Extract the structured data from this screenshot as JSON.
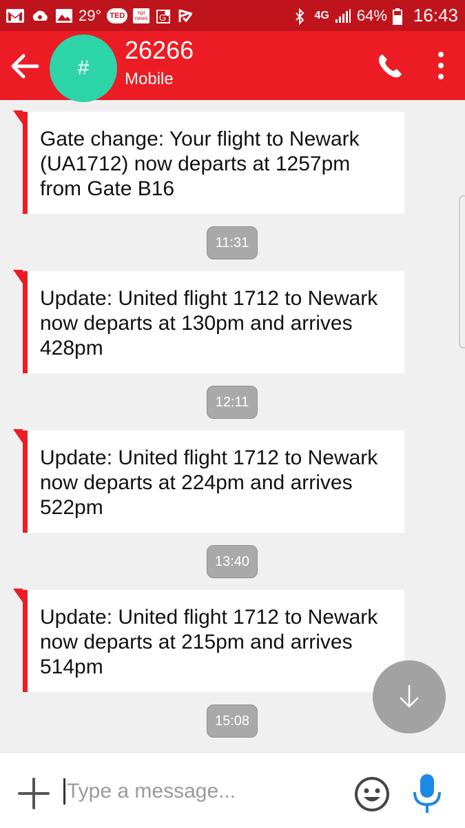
{
  "status_bar": {
    "temperature": "29°",
    "ted_label": "TED",
    "news_label": "npr news",
    "network": "4G",
    "battery_percent": "64%",
    "time": "16:43",
    "icons": [
      "gmail-icon",
      "cloud-icon",
      "gallery-icon",
      "ted-icon",
      "news-icon",
      "maps-icon",
      "checkmark-flag-icon",
      "bluetooth-icon",
      "network-icon",
      "signal-icon",
      "battery-icon"
    ]
  },
  "header": {
    "avatar_symbol": "#",
    "contact_name": "26266",
    "contact_type": "Mobile",
    "colors": {
      "bar": "#ec1c24",
      "status": "#c0141c",
      "avatar": "#2dd4a7"
    }
  },
  "messages": [
    {
      "text": "Gate change: Your flight to Newark (UA1712) now departs at 1257pm from Gate B16",
      "time": "11:31"
    },
    {
      "text": "Update: United flight 1712 to Newark now departs at 130pm and arrives 428pm",
      "time": "12:11"
    },
    {
      "text": "Update: United flight 1712 to Newark now departs at 224pm and arrives 522pm",
      "time": "13:40"
    },
    {
      "text": "Update: United flight 1712 to Newark now departs at 215pm and arrives 514pm",
      "time": "15:08"
    }
  ],
  "compose": {
    "placeholder": "Type a message...",
    "value": ""
  }
}
